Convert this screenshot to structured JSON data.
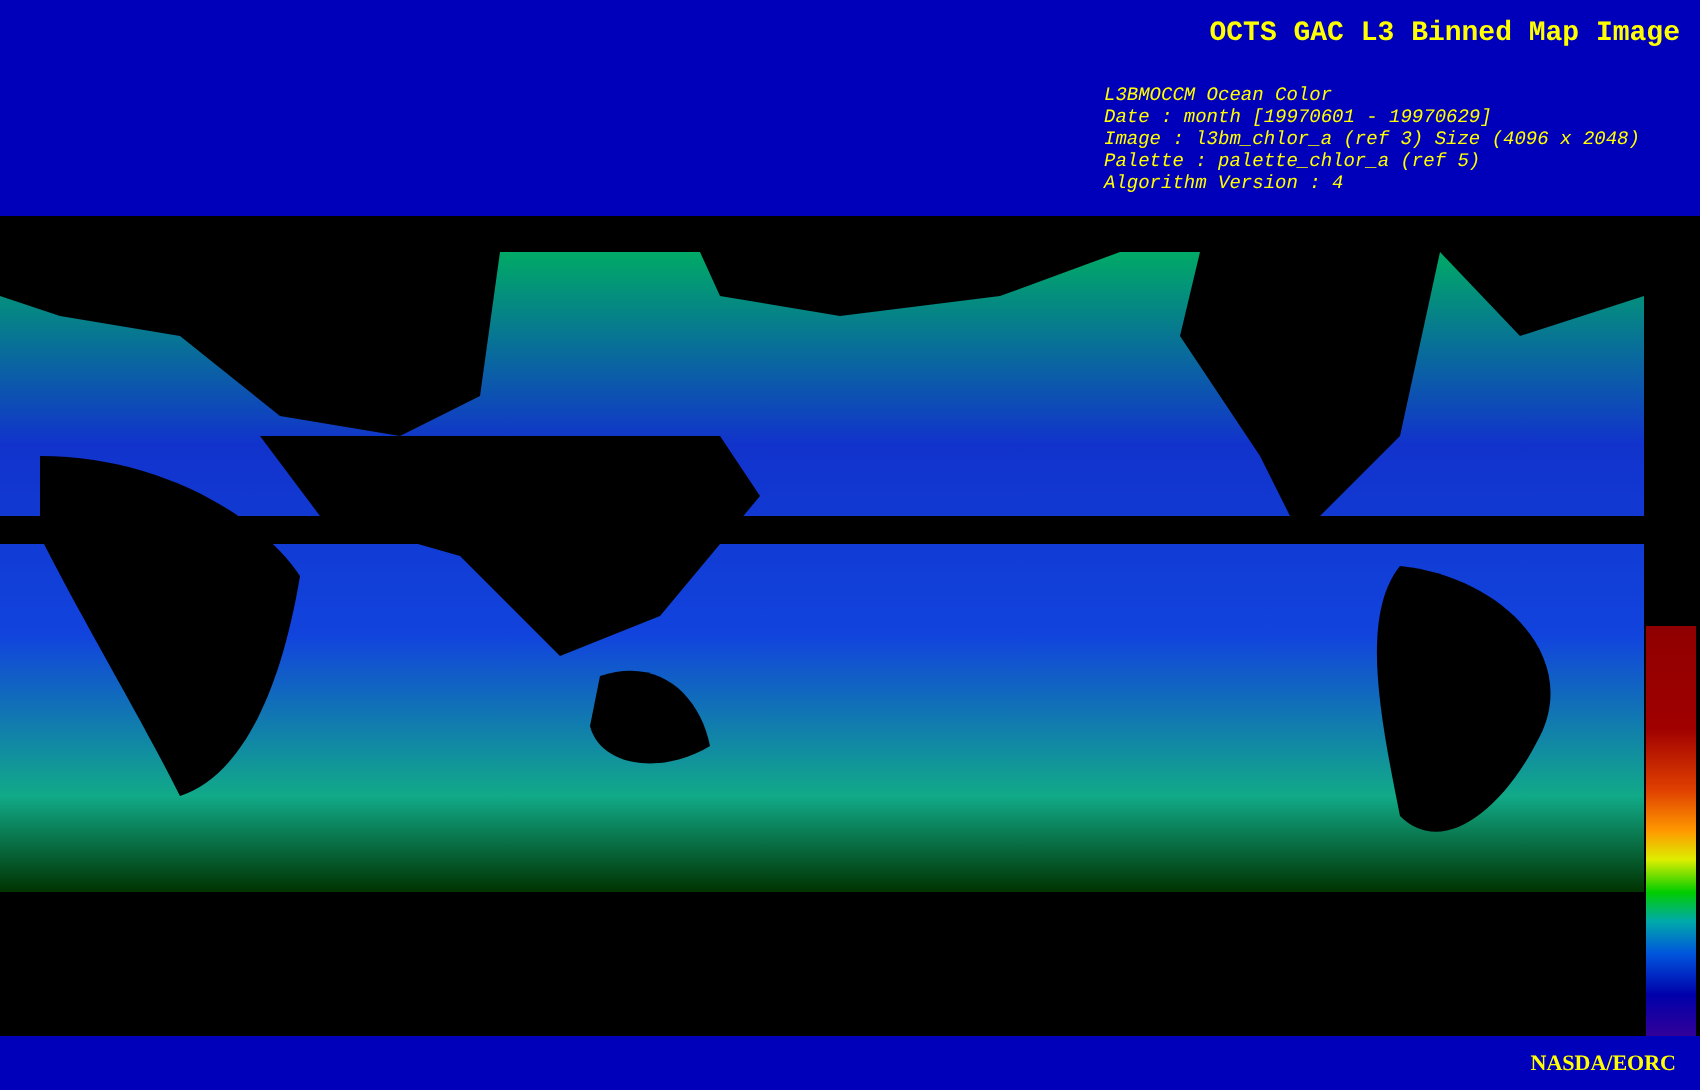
{
  "header": {
    "title": "OCTS GAC L3 Binned Map Image",
    "info_lines": [
      "L3BMOCCM Ocean Color",
      "Date : month [19970601 - 19970629]",
      "Image : l3bm_chlor_a (ref 3) Size (4096 x 2048)",
      "Palette : palette_chlor_a (ref 5)",
      "Algorithm Version : 4"
    ]
  },
  "footer": {
    "credit": "NASDA/EORC"
  }
}
